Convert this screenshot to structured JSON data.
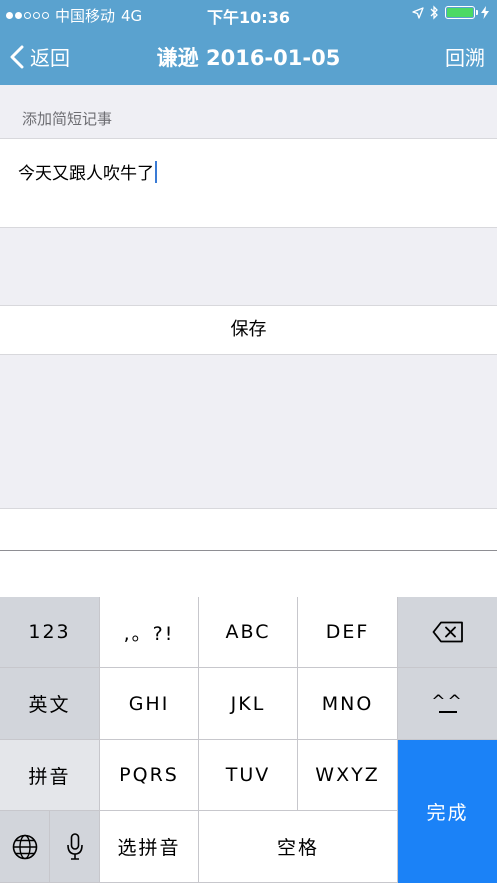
{
  "status_bar": {
    "carrier": "中国移动",
    "network": "4G",
    "time": "下午10:36"
  },
  "nav": {
    "back_label": "返回",
    "title": "谦逊 2016-01-05",
    "right_label": "回溯"
  },
  "form": {
    "section_label": "添加简短记事",
    "note_text": "今天又跟人吹牛了",
    "save_label": "保存"
  },
  "keyboard": {
    "k_123": "123",
    "k_punct": ",。?!",
    "k_abc": "ABC",
    "k_def": "DEF",
    "k_english": "英文",
    "k_ghi": "GHI",
    "k_jkl": "JKL",
    "k_mno": "MNO",
    "k_emoticon": "^^",
    "k_pinyin": "拼音",
    "k_pqrs": "PQRS",
    "k_tuv": "TUV",
    "k_wxyz": "WXYZ",
    "k_done": "完成",
    "k_select_pinyin": "选拼音",
    "k_space": "空格"
  },
  "colors": {
    "nav_bg": "#5aa2cf",
    "done_key": "#1b82f7",
    "battery": "#4cd964"
  },
  "icons": {
    "signal": "signal-dots-icon",
    "location": "location-arrow-icon",
    "bluetooth": "bluetooth-icon",
    "battery": "battery-icon",
    "charging": "charging-bolt-icon",
    "back": "chevron-left-icon",
    "delete": "backspace-icon",
    "globe": "globe-icon",
    "mic": "microphone-icon"
  }
}
